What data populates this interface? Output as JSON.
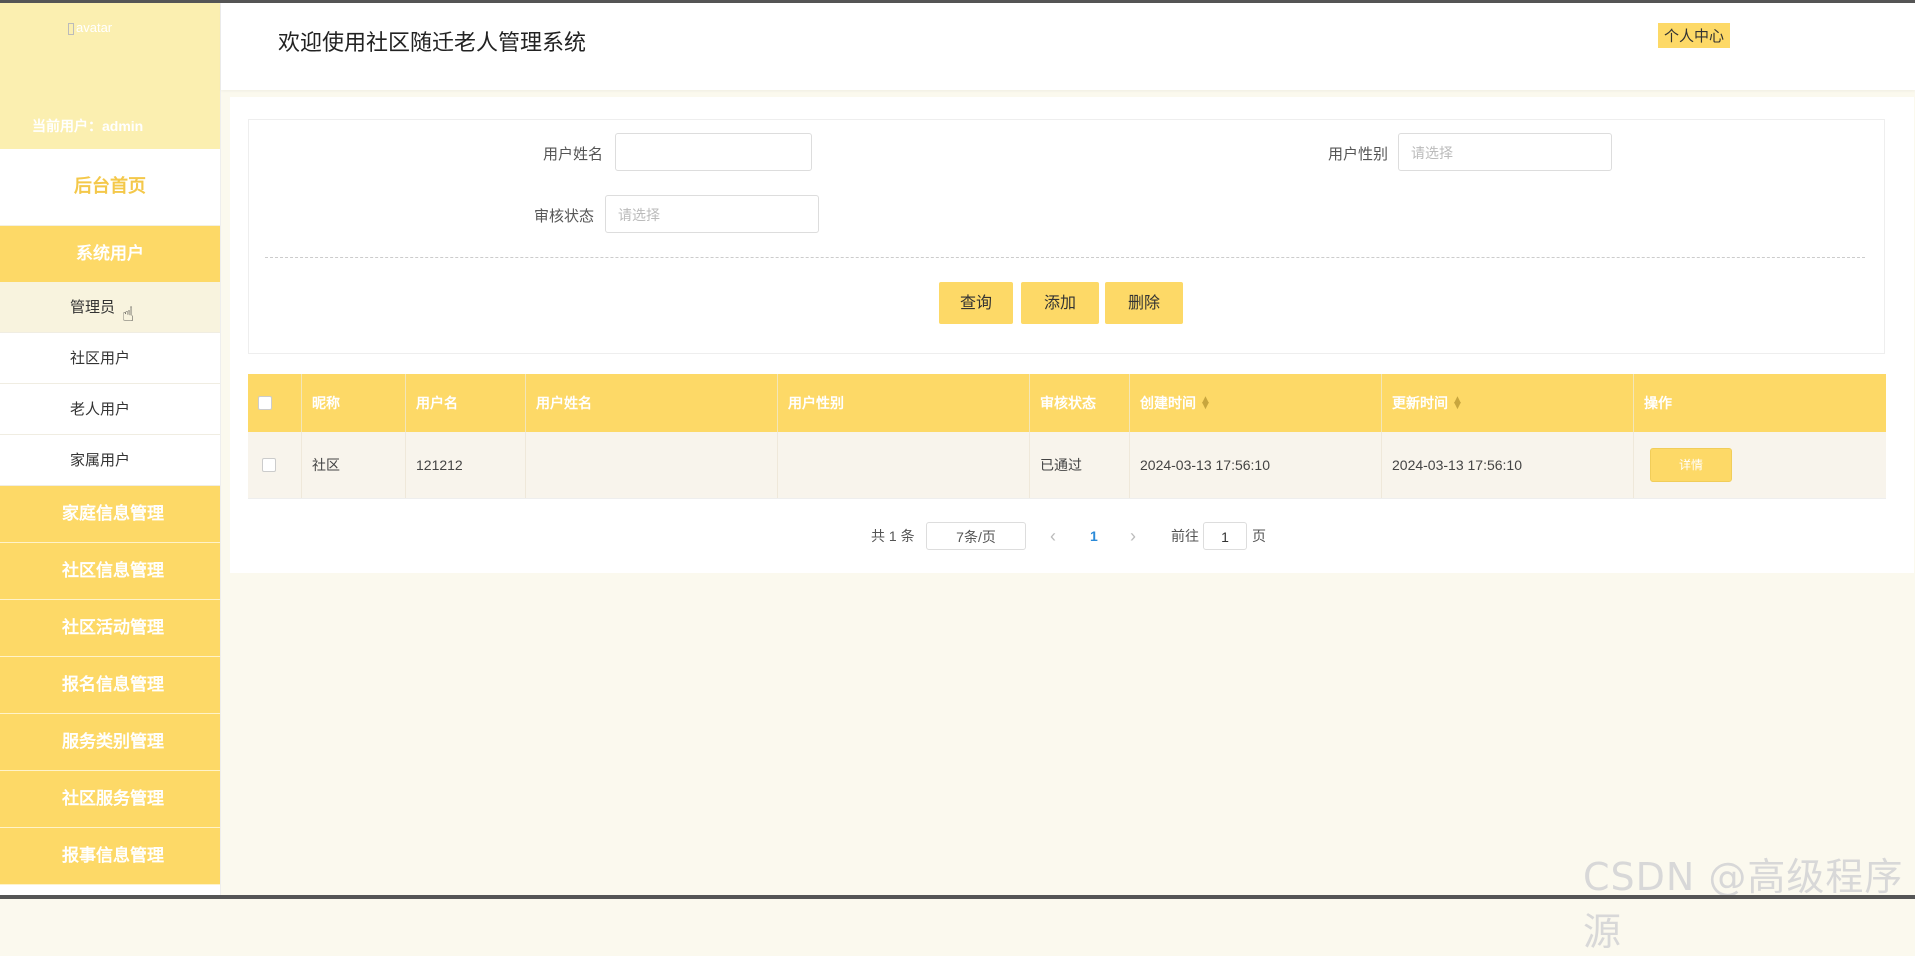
{
  "app": {
    "title": "欢迎使用社区随迁老人管理系统",
    "user_center": "个人中心"
  },
  "sidebar": {
    "avatar_alt": "avatar",
    "current_user": "当前用户：admin",
    "home": "后台首页",
    "group": "系统用户",
    "sub_items": [
      "管理员",
      "社区用户",
      "老人用户",
      "家属用户"
    ],
    "items": [
      "家庭信息管理",
      "社区信息管理",
      "社区活动管理",
      "报名信息管理",
      "服务类别管理",
      "社区服务管理",
      "报事信息管理"
    ]
  },
  "search": {
    "name_label": "用户姓名",
    "name_value": "",
    "gender_label": "用户性别",
    "gender_placeholder": "请选择",
    "status_label": "审核状态",
    "status_placeholder": "请选择",
    "query": "查询",
    "add": "添加",
    "delete": "删除"
  },
  "table": {
    "headers": [
      "昵称",
      "用户名",
      "用户姓名",
      "用户性别",
      "审核状态",
      "创建时间",
      "更新时间",
      "操作"
    ],
    "rows": [
      {
        "nickname": "社区",
        "username": "121212",
        "realname": "",
        "gender": "",
        "status": "已通过",
        "created": "2024-03-13 17:56:10",
        "updated": "2024-03-13 17:56:10",
        "action": "详情"
      }
    ]
  },
  "pagination": {
    "total": "共 1 条",
    "page_size": "7条/页",
    "current": "1",
    "goto_label": "前往",
    "goto_value": "1",
    "page_suffix": "页",
    "prev": "‹",
    "next": "›"
  },
  "watermark": "CSDN @高级程序源",
  "colors": {
    "accent": "#fdd967",
    "header_bg": "#fbefb0",
    "home_text": "#f4c84a"
  }
}
